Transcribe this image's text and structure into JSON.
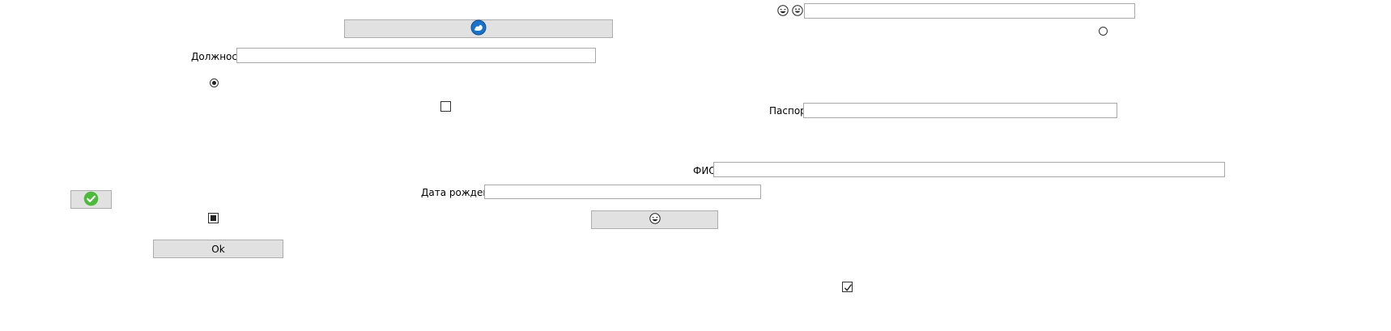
{
  "form": {
    "position_label": "Должность",
    "position_value": "",
    "passport_label": "Паспорт",
    "passport_value": "",
    "fio_label": "ФИО",
    "fio_value": "",
    "birthdate_label": "Дата рождения",
    "birthdate_value": "",
    "top_field_value": ""
  },
  "buttons": {
    "ok_label": "Ok"
  },
  "icons": {
    "top_button_icon": "blue-logo-icon",
    "check_button_icon": "green-checkmark-icon",
    "emoji_button_icon": "laughing-face-icon",
    "top_emoji_1": "laughing-face-icon",
    "top_emoji_2": "grinning-face-icon"
  },
  "controls": {
    "radio_left_selected": true,
    "radio_right_selected": false,
    "checkbox_top_checked": false,
    "checkbox_mid_state": "indeterminate",
    "checkbox_bottom_checked": true
  },
  "colors": {
    "button_bg": "#e1e1e1",
    "accent_blue": "#1a73c8",
    "accent_green": "#4cbb3c"
  }
}
